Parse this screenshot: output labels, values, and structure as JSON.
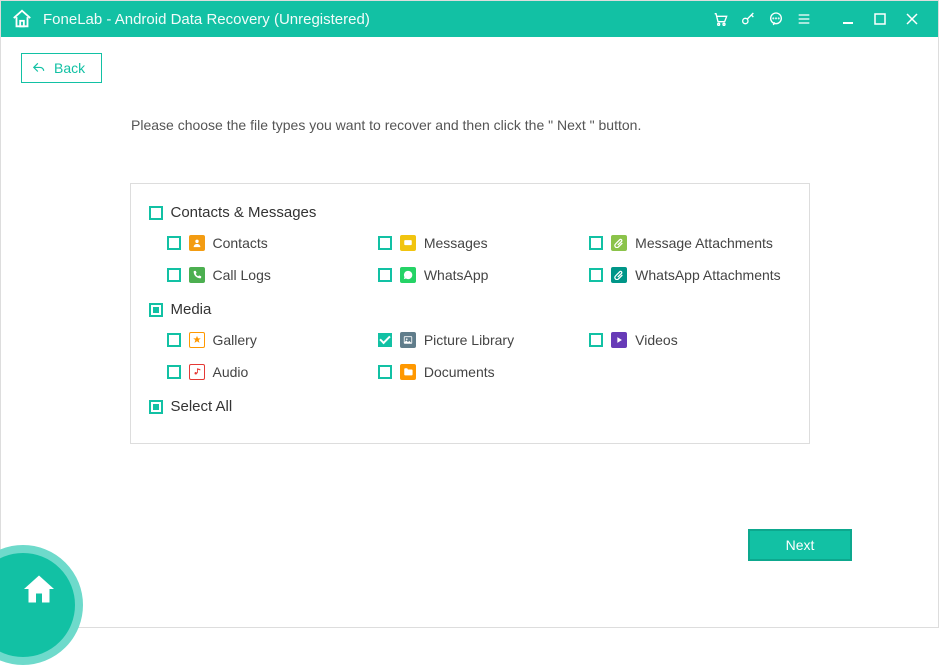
{
  "titlebar": {
    "title": "FoneLab - Android Data Recovery (Unregistered)"
  },
  "back": {
    "label": "Back"
  },
  "instruction": "Please choose the file types you want to recover and then click the \" Next \" button.",
  "sections": {
    "contacts": {
      "label": "Contacts & Messages"
    },
    "media": {
      "label": "Media"
    },
    "selectAll": {
      "label": "Select All"
    }
  },
  "items": {
    "contacts": {
      "label": "Contacts"
    },
    "messages": {
      "label": "Messages"
    },
    "msgAttach": {
      "label": "Message Attachments"
    },
    "callLogs": {
      "label": "Call Logs"
    },
    "whatsapp": {
      "label": "WhatsApp"
    },
    "waAttach": {
      "label": "WhatsApp Attachments"
    },
    "gallery": {
      "label": "Gallery"
    },
    "picLib": {
      "label": "Picture Library"
    },
    "videos": {
      "label": "Videos"
    },
    "audio": {
      "label": "Audio"
    },
    "documents": {
      "label": "Documents"
    }
  },
  "next": {
    "label": "Next"
  },
  "colors": {
    "accent": "#12c1a4",
    "contacts": "#f39c12",
    "messages": "#f1c40f",
    "msgAttach": "#8bc34a",
    "callLogs": "#4caf50",
    "whatsapp": "#25d366",
    "waAttach": "#009688",
    "gallery": "#ff9800",
    "picLib": "#607d8b",
    "videos": "#673ab7",
    "audio": "#e53935",
    "documents": "#ff9800"
  }
}
